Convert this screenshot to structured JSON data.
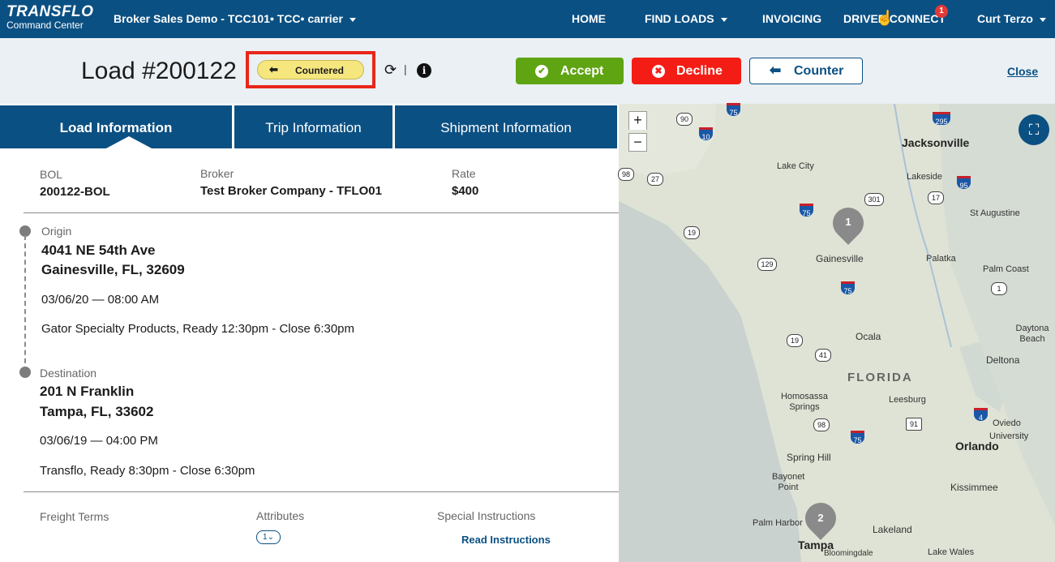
{
  "nav": {
    "brand": "TRANSFLO",
    "brand_sub": "Command Center",
    "company": "Broker Sales Demo - TCC101• TCC• carrier",
    "home": "HOME",
    "find_loads": "FIND LOADS",
    "invoicing": "INVOICING",
    "driver_connect": "DRIVER CONNECT",
    "driver_connect_badge": "1",
    "user": "Curt Terzo"
  },
  "header": {
    "load_title": "Load #200122",
    "status": "Countered",
    "accept": "Accept",
    "decline": "Decline",
    "counter": "Counter",
    "close": "Close"
  },
  "tabs": [
    "Load Information",
    "Trip Information",
    "Shipment Information"
  ],
  "summary": {
    "bol_label": "BOL",
    "bol": "200122-BOL",
    "broker_label": "Broker",
    "broker": "Test Broker Company - TFLO01",
    "rate_label": "Rate",
    "rate": "$400"
  },
  "origin": {
    "label": "Origin",
    "line1": "4041 NE 54th Ave",
    "line2": "Gainesville, FL, 32609",
    "datetime": "03/06/20 — 08:00 AM",
    "note": "Gator Specialty Products, Ready 12:30pm - Close 6:30pm"
  },
  "destination": {
    "label": "Destination",
    "line1": "201 N Franklin",
    "line2": "Tampa, FL, 33602",
    "datetime": "03/06/19 — 04:00 PM",
    "note": "Transflo, Ready 8:30pm - Close 6:30pm"
  },
  "footer": {
    "freight_terms": "Freight Terms",
    "attributes": "Attributes",
    "attributes_count": "1",
    "special_instructions": "Special Instructions",
    "read_instructions": "Read Instructions"
  },
  "map": {
    "zoom_in": "+",
    "zoom_out": "−",
    "state_label": "FLORIDA",
    "pin1": "1",
    "pin2": "2",
    "cities": {
      "jacksonville": "Jacksonville",
      "lake_city": "Lake City",
      "lakeside": "Lakeside",
      "st_augustine": "St Augustine",
      "gainesville": "Gainesville",
      "palatka": "Palatka",
      "palm_coast": "Palm Coast",
      "ocala": "Ocala",
      "daytona_beach": "Daytona Beach",
      "deltona": "Deltona",
      "homosassa_springs": "Homosassa Springs",
      "leesburg": "Leesburg",
      "oviedo": "Oviedo",
      "university": "University",
      "orlando": "Orlando",
      "spring_hill": "Spring Hill",
      "bayonet_point": "Bayonet Point",
      "kissimmee": "Kissimmee",
      "palm_harbor": "Palm Harbor",
      "lakeland": "Lakeland",
      "tampa": "Tampa",
      "bloomingdale": "Bloomingdale",
      "lake_wales": "Lake Wales"
    },
    "routes": {
      "us90": "90",
      "i10": "10",
      "i75a": "75",
      "i295": "295",
      "us98a": "98",
      "r27": "27",
      "us301": "301",
      "r17": "17",
      "i95": "95",
      "i75b": "75",
      "us19a": "19",
      "r129": "129",
      "i75c": "75",
      "us1": "1",
      "us19b": "19",
      "r41": "41",
      "r91": "91",
      "us98b": "98",
      "i4": "4",
      "i75d": "75"
    }
  },
  "colors": {
    "nav_bg": "#0b5083",
    "accept": "#5fa412",
    "decline": "#f41d15",
    "status_pill": "#f5e67e",
    "highlight_border": "#e8261b"
  }
}
